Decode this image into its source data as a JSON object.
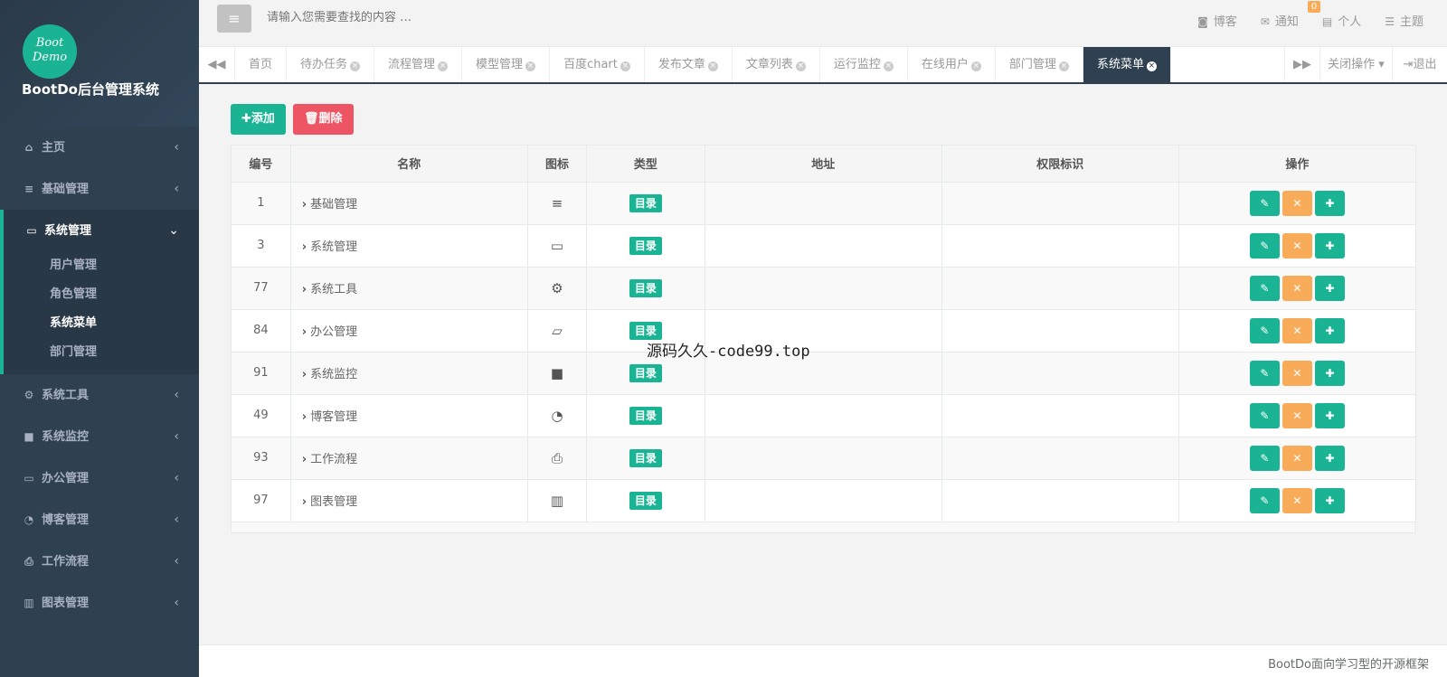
{
  "sidebar": {
    "logo_line1": "Boot",
    "logo_line2": "Demo",
    "title": "BootDo后台管理系统",
    "items": [
      {
        "label": "主页",
        "icon": "home-icon"
      },
      {
        "label": "基础管理",
        "icon": "bars-icon"
      },
      {
        "label": "系统管理",
        "icon": "desktop-icon",
        "children": [
          "用户管理",
          "角色管理",
          "系统菜单",
          "部门管理"
        ],
        "current_child": "系统菜单"
      },
      {
        "label": "系统工具",
        "icon": "gear-icon"
      },
      {
        "label": "系统监控",
        "icon": "video-icon"
      },
      {
        "label": "办公管理",
        "icon": "laptop-icon"
      },
      {
        "label": "博客管理",
        "icon": "rss-icon"
      },
      {
        "label": "工作流程",
        "icon": "print-icon"
      },
      {
        "label": "图表管理",
        "icon": "bar-chart-icon"
      }
    ]
  },
  "topbar": {
    "search_placeholder": "请输入您需要查找的内容 …",
    "blog": "博客",
    "notice": "通知",
    "notice_count": "0",
    "profile": "个人",
    "theme": "主题"
  },
  "tabs": {
    "items": [
      "首页",
      "待办任务",
      "流程管理",
      "模型管理",
      "百度chart",
      "发布文章",
      "文章列表",
      "运行监控",
      "在线用户",
      "部门管理",
      "系统菜单"
    ],
    "active": "系统菜单",
    "close_ops": "关闭操作",
    "logout": "退出"
  },
  "toolbar": {
    "add_label": "添加",
    "delete_label": "删除"
  },
  "table": {
    "headers": [
      "编号",
      "名称",
      "图标",
      "类型",
      "地址",
      "权限标识",
      "操作"
    ],
    "rows": [
      {
        "id": "1",
        "name": "基础管理",
        "icon": "bars-icon",
        "type": "目录",
        "url": "",
        "perms": ""
      },
      {
        "id": "3",
        "name": "系统管理",
        "icon": "desktop-icon",
        "type": "目录",
        "url": "",
        "perms": ""
      },
      {
        "id": "77",
        "name": "系统工具",
        "icon": "gear-icon",
        "type": "目录",
        "url": "",
        "perms": ""
      },
      {
        "id": "84",
        "name": "办公管理",
        "icon": "laptop-icon",
        "type": "目录",
        "url": "",
        "perms": ""
      },
      {
        "id": "91",
        "name": "系统监控",
        "icon": "video-icon",
        "type": "目录",
        "url": "",
        "perms": ""
      },
      {
        "id": "49",
        "name": "博客管理",
        "icon": "rss-icon",
        "type": "目录",
        "url": "",
        "perms": ""
      },
      {
        "id": "93",
        "name": "工作流程",
        "icon": "print-icon",
        "type": "目录",
        "url": "",
        "perms": ""
      },
      {
        "id": "97",
        "name": "图表管理",
        "icon": "bar-chart-icon",
        "type": "目录",
        "url": "",
        "perms": ""
      }
    ]
  },
  "watermark": "源码久久-code99.top",
  "footer": "BootDo面向学习型的开源框架",
  "colors": {
    "sidebar_bg": "#2f4050",
    "primary": "#1ab394",
    "danger": "#ed5565",
    "warning": "#f8ac59"
  }
}
